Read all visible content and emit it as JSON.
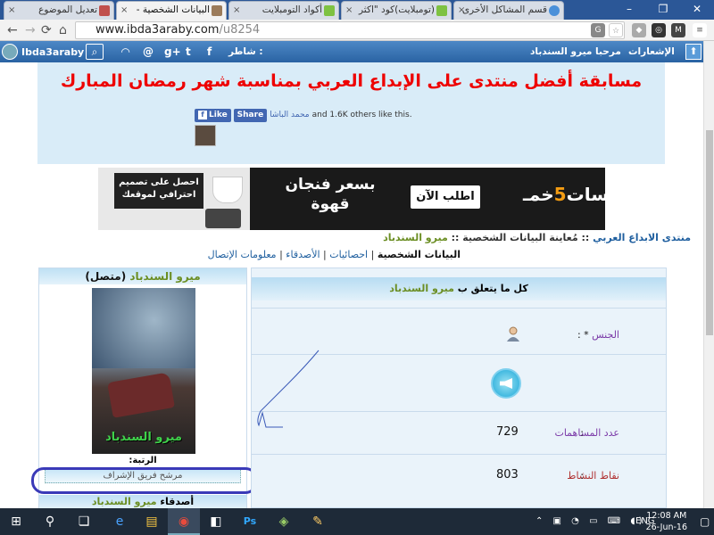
{
  "browser": {
    "tabs": [
      {
        "title": "تعديل الموضوع",
        "active": false
      },
      {
        "title": "البيانات الشخصية -",
        "active": true
      },
      {
        "title": "أكواد التومبلايت",
        "active": false
      },
      {
        "title": "(تومبلايت)كود \"اكثر",
        "active": false
      },
      {
        "title": "قسم المشاكل الأخرى",
        "active": false
      }
    ],
    "url_domain": "www.ibda3araby.com",
    "url_path": "/u8254",
    "back": "←",
    "forward": "→",
    "reload": "⟳",
    "home": "⌂",
    "close_glyph": "×",
    "window": {
      "minimize": "–",
      "restore": "❐",
      "close": "✕"
    }
  },
  "forum_bar": {
    "site_name": "Ibda3araby",
    "search_glyph": "⌕",
    "share_label": "شاطر :",
    "social": [
      "f",
      "t",
      "@",
      "g+",
      "rss"
    ],
    "welcome": "مرحبا ميرو السندباد",
    "notifications": "الإشعارات",
    "up_glyph": "⬆"
  },
  "banner": {
    "headline": "مسابقة أفضل منتدى على الإبداع العربي بمناسبة شهر رمضان المبارك",
    "like_label": "Like",
    "share_label": "Share",
    "liker_name": "محمد الباشا",
    "like_text": "and 1.6K others like this."
  },
  "ad": {
    "note_text": "احصل على تصميم احترافي لموقعك",
    "headline": "بسعر فنجان قهوة",
    "button": "اطلب الآن",
    "brand_left": "خمـ",
    "brand_five": "5",
    "brand_right": "ـسات"
  },
  "breadcrumb": {
    "forum": "منتدى الابداع العربي",
    "sep1": " :: ",
    "page": "مُعاينة البيانات الشخصية",
    "sep2": " :: ",
    "user": "ميرو السندباد"
  },
  "profile_tabs": {
    "personal": "البيانات الشخصية",
    "stats": "احصائيات",
    "friends": "الأصدقاء",
    "contact": "معلومات الإتصال",
    "divider": "|"
  },
  "left_panel": {
    "username": "ميرو السندباد",
    "status": "(متصل)",
    "image_caption": "ميرو السندباد",
    "rank_label": "الرتبة:",
    "rank_value": "مرشح فريق الإشراف",
    "friends_label": "أصدقاء",
    "friends_user": "ميرو السندباد"
  },
  "right_panel": {
    "header_prefix": "كل ما يتعلق ب",
    "header_user": "ميرو السندباد",
    "gender_label": "الجنس",
    "gender_suffix": " * :",
    "posts_label": "عدد المساهمات",
    "posts_value": "729",
    "activity_label": "نقاط النشاط",
    "activity_value": "803",
    "colon": ":"
  },
  "taskbar": {
    "start_glyph": "⊞",
    "search_glyph": "⚲",
    "taskview_glyph": "❏",
    "apps": [
      "e",
      "▤",
      "◉",
      "◧",
      "Ps",
      "◈",
      "✎"
    ],
    "tray_icons": "⌃ ▣ ◔ ▭ ⌨ ◖)",
    "language": "ENG",
    "time": "12:08 AM",
    "date": "26-Jun-16",
    "notify_glyph": "▢"
  },
  "colors": {
    "forum_bar": "#2f6dad",
    "headline_red": "#e00000",
    "username_green": "#6b8e23",
    "rank_circle": "#3a3ab8",
    "link_blue": "#1f5f9f"
  }
}
